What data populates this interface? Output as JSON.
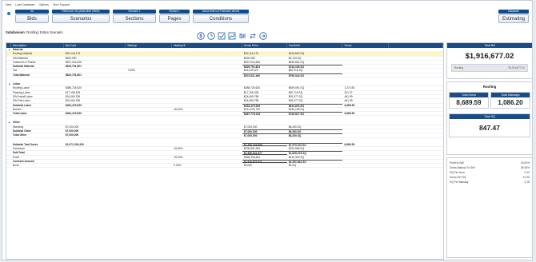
{
  "menu": [
    "New",
    "Load Database",
    "Options",
    "Tech Support"
  ],
  "toolbar": {
    "groups": [
      {
        "badge": "All",
        "button": "Bids"
      },
      {
        "badge": "Reference not yet/another sheets",
        "button": "Scenarios"
      },
      {
        "badge": "Scenario 1",
        "button": "Sections"
      },
      {
        "badge": "Section 1",
        "button": "Pages"
      },
      {
        "badge": "Above limit not Protection sheets",
        "button": "Conditions"
      }
    ],
    "right": {
      "badge": "Database",
      "button": "Estimating"
    }
  },
  "breadcrumb": {
    "label": "Subdivision:",
    "value": "Roofing: Entire Scenario"
  },
  "icons": [
    "dollar-icon",
    "clock-icon",
    "checkbox-icon",
    "chart-icon",
    "sliders-icon",
    "arrows-icon",
    "export-icon"
  ],
  "grid": {
    "columns": [
      "",
      "Description",
      "Net Cost",
      "Markup",
      "Markup $",
      "Gross Price",
      "Cost/Unit",
      "Hours"
    ],
    "rows": [
      {
        "type": "section",
        "cells": [
          "▲",
          "Material",
          "",
          "",
          "",
          "",
          "",
          ""
        ]
      },
      {
        "type": "hl",
        "cells": [
          "",
          "Roofing Material",
          "$92,146,175",
          "",
          "",
          "$92,116,175",
          "$108,690.SQ",
          ""
        ]
      },
      {
        "type": "normal",
        "cells": [
          "",
          "S/M Material",
          "$620,080",
          "",
          "",
          "$620,080",
          "$0,763.SQ",
          ""
        ]
      },
      {
        "type": "normal",
        "cells": [
          "",
          "Fasteners & Planks",
          "$537,034,826",
          "",
          "",
          "$537,034,826",
          "$535,681.SQ",
          ""
        ]
      },
      {
        "type": "bold",
        "cells": [
          "",
          "Subtotal Material",
          "$629,791,801",
          "",
          "",
          "$629,791,801",
          "$743,190.SQ",
          ""
        ]
      },
      {
        "type": "normal",
        "cells": [
          "",
          "Tax",
          "",
          "7.63%",
          "",
          "$44,049,407",
          "$52,915.SQ",
          ""
        ]
      },
      {
        "type": "bold",
        "cells": [
          "",
          "Total Material",
          "$629,791,801",
          "",
          "",
          "$674,821,400",
          "$796,044.SQ",
          ""
        ]
      },
      {
        "type": "gap",
        "cells": [
          "",
          "",
          "",
          "",
          "",
          "",
          "",
          ""
        ]
      },
      {
        "type": "section",
        "cells": [
          "▲",
          "Labor",
          "",
          "",
          "",
          "",
          "",
          ""
        ]
      },
      {
        "type": "normal",
        "cells": [
          "",
          "Roofing Labor",
          "$388,726,620",
          "",
          "",
          "$388,726,620",
          "$459,091.SQ",
          "1,274.53"
        ]
      },
      {
        "type": "normal",
        "cells": [
          "",
          "Flashing Labor",
          "$17,155,328",
          "",
          "",
          "$17,155,328",
          "$20,719.SQ",
          "201.07"
        ]
      },
      {
        "type": "normal",
        "cells": [
          "",
          "S/M Install Labor",
          "$24,069,758",
          "",
          "",
          "$24,069,758",
          "$29,077.SQ",
          "461.99"
        ]
      },
      {
        "type": "normal",
        "cells": [
          "",
          "S/M Fab Labor",
          "$24,069,758",
          "",
          "",
          "$24,069,758",
          "$29,077.SQ",
          "461.99"
        ]
      },
      {
        "type": "bold",
        "cells": [
          "",
          "Subtotal Labor",
          "$454,479,539",
          "",
          "",
          "$454,479,539",
          "$513,876.SQ",
          "6,689.59"
        ]
      },
      {
        "type": "normal",
        "cells": [
          "",
          "Burden",
          "",
          "",
          "46.00%",
          "$211,209,709",
          "$236,108.SQ",
          ""
        ]
      },
      {
        "type": "bold",
        "cells": [
          "",
          "Total Labor",
          "$454,479,539",
          "",
          "",
          "$667,778,128",
          "$749,817.SQ",
          "6,689.59"
        ]
      },
      {
        "type": "gap",
        "cells": [
          "",
          "",
          "",
          "",
          "",
          "",
          "",
          ""
        ]
      },
      {
        "type": "section",
        "cells": [
          "▲",
          "Other",
          "",
          "",
          "",
          "",
          "",
          ""
        ]
      },
      {
        "type": "normal",
        "cells": [
          "",
          "Warranty",
          "$7,000,000",
          "",
          "",
          "$7,000,000",
          "$8,260.SQ",
          ""
        ]
      },
      {
        "type": "bold",
        "cells": [
          "",
          "Subtotal Other",
          "$7,000,000",
          "",
          "",
          "$7,000,000",
          "$8,260.SQ",
          ""
        ]
      },
      {
        "type": "bold",
        "cells": [
          "",
          "Total Other",
          "$7,000,000",
          "",
          "",
          "$7,000,000",
          "$8,260.SQ",
          ""
        ]
      },
      {
        "type": "gap",
        "cells": [
          "",
          "",
          "",
          "",
          "",
          "",
          "",
          ""
        ]
      },
      {
        "type": "bold",
        "cells": [
          "",
          "Subtotal Tax/Choice",
          "$1,071,292,400",
          "",
          "",
          "$1,350,349,598",
          "$1,575,210.SQ",
          "6,689.59"
        ]
      },
      {
        "type": "normal",
        "cells": [
          "",
          "Overhead",
          "",
          "",
          "15.00%",
          "$200,651,909",
          "$233,996.SQ",
          ""
        ]
      },
      {
        "type": "bold",
        "cells": [
          "",
          "Sub/Total",
          "",
          "",
          "",
          "$1,550,941,877",
          "$1,808,215.SQ",
          ""
        ]
      },
      {
        "type": "normal",
        "cells": [
          "",
          "Profit",
          "",
          "",
          "25.00%",
          "$365,335,464",
          "$410,329.SQ",
          ""
        ]
      },
      {
        "type": "bold",
        "cells": [
          "",
          "Contract Amount",
          "",
          "",
          "",
          "$1,916,677,021",
          "$2,261,844.SQ",
          ""
        ]
      },
      {
        "type": "normal",
        "cells": [
          "",
          "Bond",
          "",
          "",
          "0.00%",
          "$0,000",
          "$0.SQ",
          ""
        ]
      }
    ]
  },
  "summary": {
    "total_label": "Total Bill",
    "total_value": "$1,916,677.02",
    "slider_left": "Roofing",
    "slider_right": "$1,916,677.02",
    "section_title": "Roofing",
    "hours_label": "Total Hours",
    "hours_value": "8,689.59",
    "mandays_label": "Total Mandays",
    "mandays_value": "1,086.20",
    "sq_label": "Total SQ",
    "sq_value": "847.47",
    "metrics": [
      {
        "label": "Profit to Sell",
        "value": "20.00%"
      },
      {
        "label": "Gross Markup To Sell",
        "value": "39.45%"
      },
      {
        "label": "SQ Per Hour",
        "value": "0.10"
      },
      {
        "label": "Hours Per SQ",
        "value": "10.25"
      },
      {
        "label": "SQ Per Manday",
        "value": "0.78"
      }
    ]
  },
  "colors": {
    "header_blue": "#1a4c86",
    "highlight": "#fdf6c6"
  }
}
